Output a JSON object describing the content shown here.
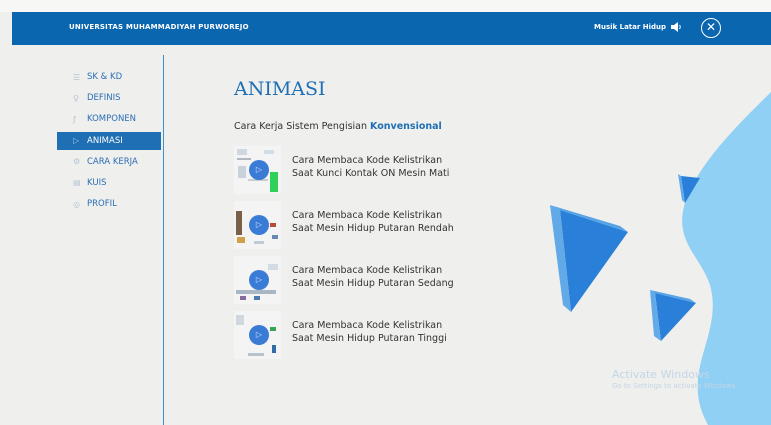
{
  "header": {
    "university": "UNIVERSITAS MUHAMMADIYAH PURWOREJO",
    "music_label": "Musik Latar Hidup",
    "speaker_icon": "speaker-icon",
    "close_icon": "close-icon",
    "close_symbol": "✕"
  },
  "sidebar": {
    "items": [
      {
        "label": "SK & KD",
        "icon": "document-icon",
        "glyph": "☰",
        "active": false
      },
      {
        "label": "DEFINIS",
        "icon": "bulb-icon",
        "glyph": "♀",
        "active": false
      },
      {
        "label": "KOMPONEN",
        "icon": "tool-icon",
        "glyph": "ƒ",
        "active": false
      },
      {
        "label": "ANIMASI",
        "icon": "play-icon",
        "glyph": "▷",
        "active": true
      },
      {
        "label": "CARA KERJA",
        "icon": "gear-icon",
        "glyph": "⚙",
        "active": false
      },
      {
        "label": "KUIS",
        "icon": "quiz-icon",
        "glyph": "▤",
        "active": false
      },
      {
        "label": "PROFIL",
        "icon": "profile-icon",
        "glyph": "◎",
        "active": false
      }
    ]
  },
  "main": {
    "title": "ANIMASI",
    "subtitle_prefix": "Cara Kerja Sistem Pengisian",
    "subtitle_highlight": "Konvensional",
    "animations": [
      {
        "line1": "Cara Membaca Kode Kelistrikan",
        "line2": "Saat Kunci Kontak ON Mesin Mati"
      },
      {
        "line1": "Cara Membaca Kode Kelistrikan",
        "line2": "Saat Mesin Hidup Putaran Rendah"
      },
      {
        "line1": "Cara Membaca Kode Kelistrikan",
        "line2": "Saat Mesin Hidup Putaran Sedang"
      },
      {
        "line1": "Cara Membaca Kode Kelistrikan",
        "line2": "Saat Mesin Hidup Putaran Tinggi"
      }
    ],
    "play_glyph": "▷"
  },
  "watermark": {
    "title": "Activate Windows",
    "sub": "Go to Settings to activate Windows."
  },
  "colors": {
    "header_blue": "#0b66b0",
    "accent_blue": "#1f6fb5",
    "wave_blue": "#8fd0f4"
  }
}
